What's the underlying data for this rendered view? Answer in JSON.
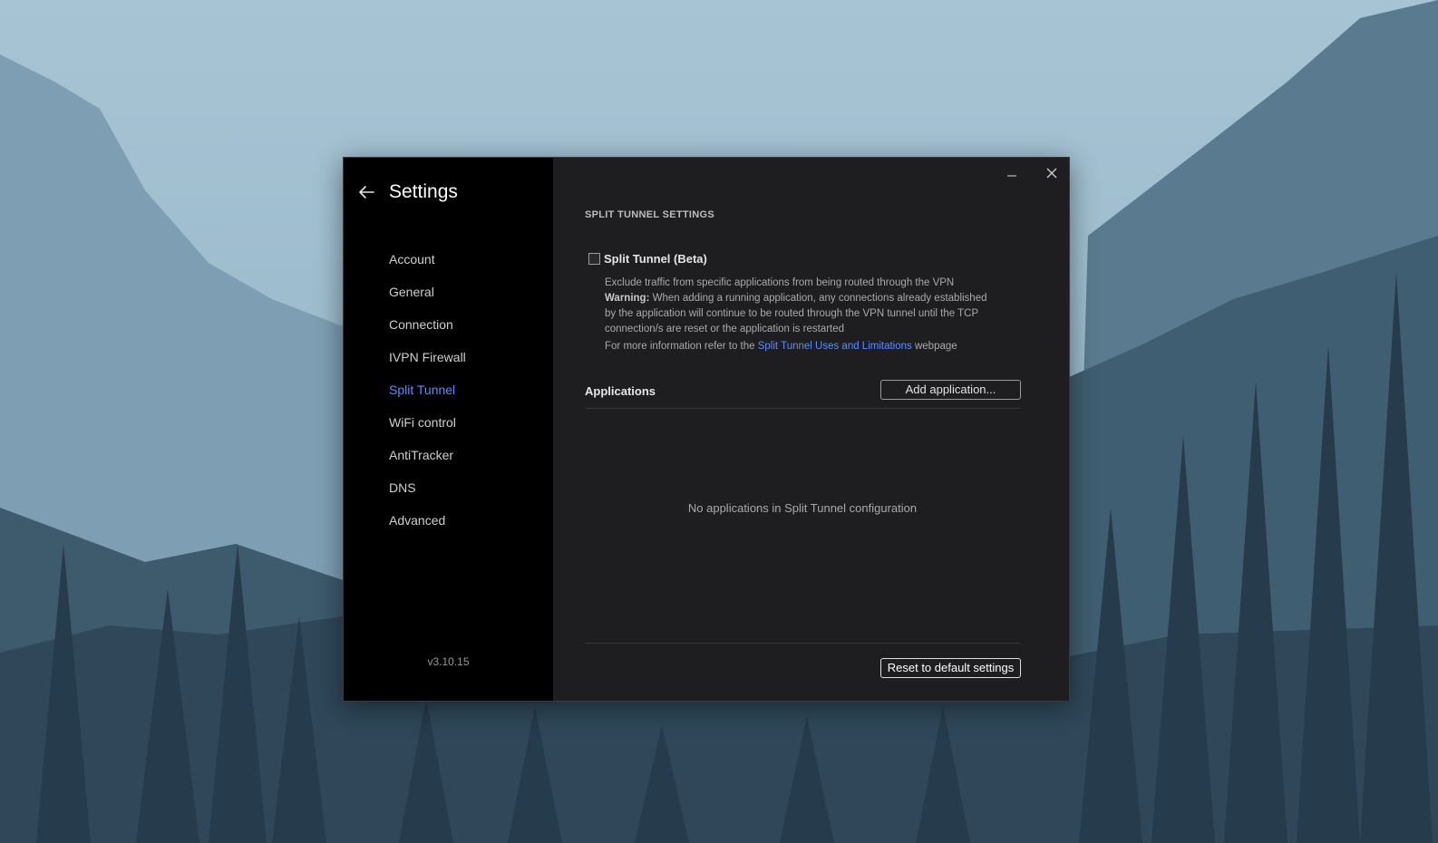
{
  "sidebar": {
    "title": "Settings",
    "items": [
      {
        "label": "Account"
      },
      {
        "label": "General"
      },
      {
        "label": "Connection"
      },
      {
        "label": "IVPN Firewall"
      },
      {
        "label": "Split Tunnel"
      },
      {
        "label": "WiFi control"
      },
      {
        "label": "AntiTracker"
      },
      {
        "label": "DNS"
      },
      {
        "label": "Advanced"
      }
    ],
    "active_item": "Split Tunnel",
    "version": "v3.10.15"
  },
  "content": {
    "section_title": "SPLIT TUNNEL SETTINGS",
    "split_tunnel_checkbox": {
      "label": "Split Tunnel (Beta)",
      "checked": false
    },
    "description": {
      "line1": "Exclude traffic from specific applications from being routed through the VPN",
      "warning_label": "Warning:",
      "warning_text": " When adding a running application, any connections already established by the application will continue to be routed through the VPN tunnel until the TCP connection/s are reset or the application is restarted",
      "more_prefix": "For more information refer to the ",
      "more_link": "Split Tunnel Uses and Limitations",
      "more_suffix": " webpage"
    },
    "applications_label": "Applications",
    "add_application_button": "Add application...",
    "empty_message": "No applications in Split Tunnel configuration",
    "reset_button": "Reset to default settings"
  },
  "icons": {
    "back": "arrow-left-icon",
    "minimize": "minimize-icon",
    "close": "close-icon"
  },
  "colors": {
    "accent": "#5c8cff",
    "sidebar_bg": "#000000",
    "content_bg": "#1e1e21"
  }
}
